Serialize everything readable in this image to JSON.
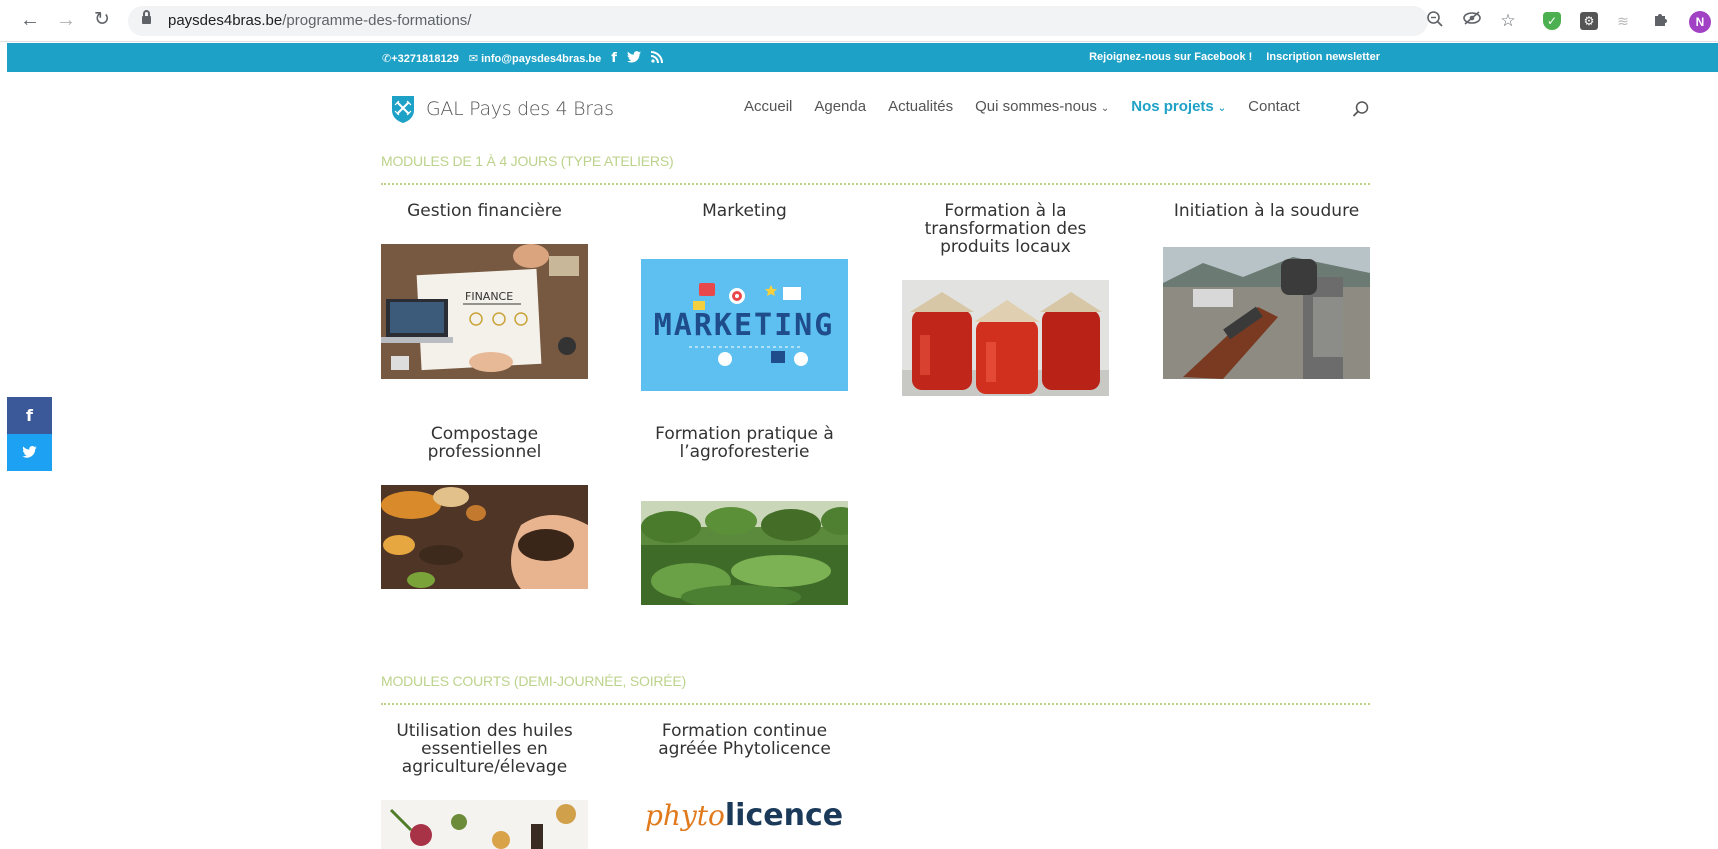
{
  "browser": {
    "url_host": "paysdes4bras.be",
    "url_path": "/programme-des-formations/",
    "profile_initial": "N"
  },
  "topbar": {
    "phone": "+3271818129",
    "email": "info@paysdes4bras.be",
    "facebook_link": "Rejoignez-nous sur Facebook !",
    "newsletter_link": "Inscription newsletter",
    "bar_color": "#1ea1c6"
  },
  "header": {
    "logo_text": "GAL Pays des 4 Bras",
    "menu": {
      "accueil": "Accueil",
      "agenda": "Agenda",
      "actualites": "Actualités",
      "qui": "Qui sommes-nous",
      "projets": "Nos projets",
      "contact": "Contact"
    },
    "accent_color": "#1ea1c6"
  },
  "sections": [
    {
      "title": "MODULES DE 1 À 4 JOURS (TYPE ATELIERS)",
      "cards": [
        {
          "title": "Gestion financière",
          "image": "finance-desk-photo",
          "image_text": "FINANCE"
        },
        {
          "title": "Marketing",
          "image": "marketing-illustration",
          "image_text": "MARKETING"
        },
        {
          "title": "Formation à la transformation des produits locaux",
          "image": "tomato-jars-photo"
        },
        {
          "title": "Initiation à la soudure",
          "image": "welding-photo"
        },
        {
          "title": "Compostage professionnel",
          "image": "compost-hands-photo"
        },
        {
          "title": "Formation pratique à l’agroforesterie",
          "image": "agroforestry-field-photo"
        }
      ]
    },
    {
      "title": "MODULES COURTS (DEMI-JOURNÉE, SOIRÉE)",
      "cards": [
        {
          "title": "Utilisation des huiles essentielles en agriculture/élevage",
          "image": "essential-oils-photo"
        },
        {
          "title": "Formation continue agréée Phytolicence",
          "image": "phytolicence-logo",
          "logo_part1": "phyto",
          "logo_part2": "licence"
        }
      ]
    }
  ],
  "share": {
    "facebook": "f",
    "twitter": "twitter-bird-icon"
  },
  "colors": {
    "section_title": "#bcd38c",
    "facebook": "#3b5998",
    "twitter": "#1da1f2"
  }
}
